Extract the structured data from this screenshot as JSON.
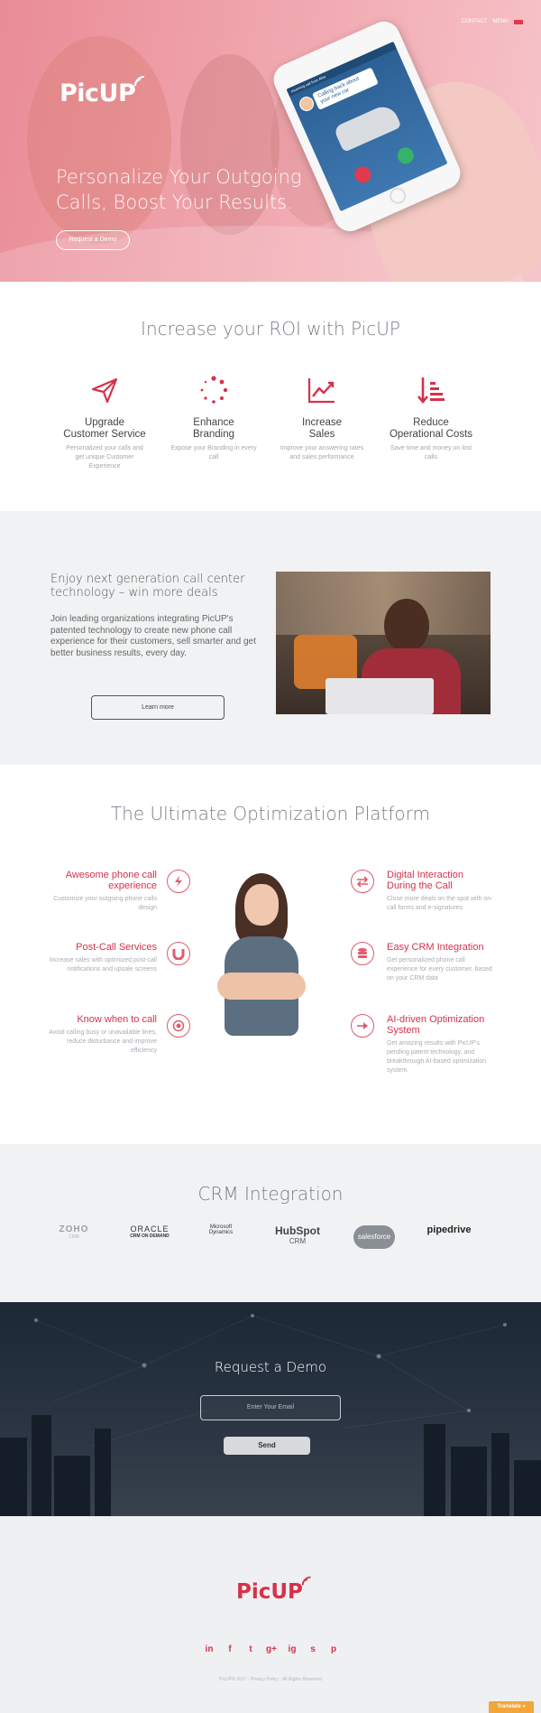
{
  "nav": {
    "contact": "CONTACT",
    "menu": "MENU"
  },
  "hero": {
    "brand": "PicUP",
    "headline_line1": "Personalize Your Outgoing",
    "headline_line2": "Calls, Boost Your Results.",
    "cta": "Request a Demo",
    "phone": {
      "topbar": "Incoming call from Ahia",
      "bubble": "Calling back about your new car"
    }
  },
  "roi": {
    "title": "Increase your ROI with PicUP",
    "features": [
      {
        "title1": "Upgrade",
        "title2": "Customer Service",
        "desc": "Personalized your calls and get unique Customer Experience",
        "icon": "paper-plane-icon"
      },
      {
        "title1": "Enhance",
        "title2": "Branding",
        "desc": "Expose your Branding in every call",
        "icon": "dotted-circle-icon"
      },
      {
        "title1": "Increase",
        "title2": "Sales",
        "desc": "Improve your answering rates and sales performance",
        "icon": "line-chart-icon"
      },
      {
        "title1": "Reduce",
        "title2": "Operational Costs",
        "desc": "Save time and money on lost calls",
        "icon": "sort-descending-icon"
      }
    ]
  },
  "enjoy": {
    "title": "Enjoy next generation call center technology – win more deals",
    "body": "Join leading organizations integrating PicUP's patented technology to create new phone call experience for their customers, sell smarter and get better business results, every day.",
    "button": "Learn more"
  },
  "ultimate": {
    "title": "The Ultimate Optimization Platform",
    "left": [
      {
        "title": "Awesome phone call experience",
        "desc": "Customize your outgoing phone calls design",
        "icon": "lightning-icon"
      },
      {
        "title": "Post-Call Services",
        "desc": "Increase sales with optimized post-call notifications and upsale screens",
        "icon": "magnet-icon"
      },
      {
        "title": "Know when to call",
        "desc": "Avoid calling busy or unavailable lines, reduce disturbance and improve efficiency",
        "icon": "target-icon"
      }
    ],
    "right": [
      {
        "title": "Digital Interaction During the Call",
        "desc": "Close more deals on the spot with on-call forms and e-signatures",
        "icon": "arrows-exchange-icon"
      },
      {
        "title": "Easy CRM Integration",
        "desc": "Get personalized phone call experience for every customer, based on your CRM data",
        "icon": "database-icon"
      },
      {
        "title": "AI-driven Optimization System",
        "desc": "Get amazing results with PicUP's pending patent technology, and breakthrough AI-based optimization system.",
        "icon": "arrow-target-icon"
      }
    ]
  },
  "crm": {
    "title": "CRM Integration",
    "logos": {
      "zoho": "ZOHO",
      "zoho_sub": "CRM",
      "oracle": "ORACLE",
      "oracle_sub": "CRM ON DEMAND",
      "microsoft": "Microsoft",
      "microsoft_sub": "Dynamics",
      "hubspot": "HubSpot",
      "hubspot_sub": "CRM",
      "salesforce": "salesforce",
      "pipedrive": "pipedrive"
    }
  },
  "demo": {
    "title": "Request a Demo",
    "email_placeholder": "Enter Your Email",
    "send": "Send"
  },
  "footer": {
    "brand": "PicUP",
    "socials": [
      "in",
      "f",
      "t",
      "g+",
      "ig",
      "s",
      "p"
    ],
    "copyright": "PicUP® 2017 · Privacy Policy · All Rights Reserved",
    "translate": "Translate »"
  },
  "colors": {
    "brand_red": "#d5324a",
    "hero_pink": "#ef9aa3",
    "dark_bg": "#1b2836",
    "light_bg": "#f1f2f3",
    "translate_orange": "#f2a63a"
  }
}
